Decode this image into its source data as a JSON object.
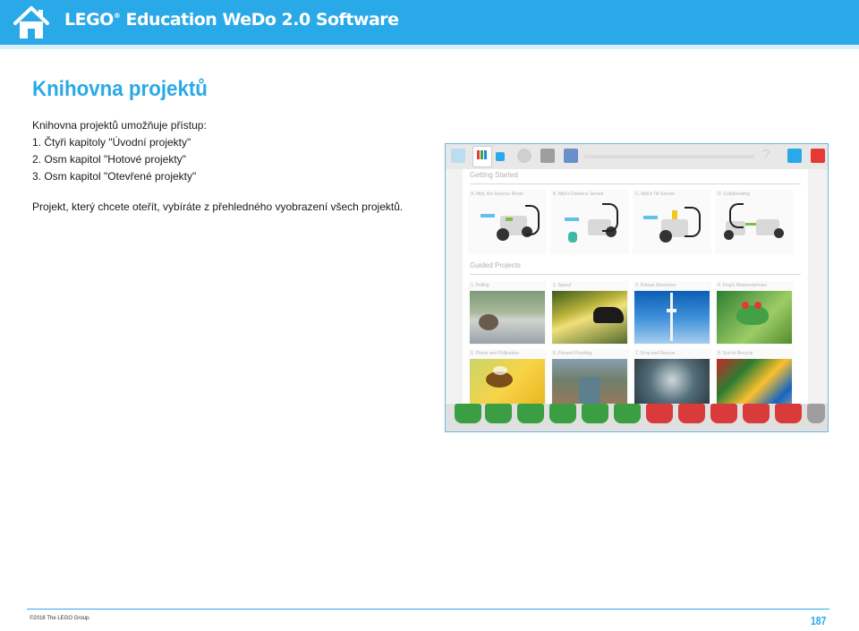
{
  "header": {
    "title_brand": "LEGO",
    "title_reg": "®",
    "title_rest": " Education WeDo 2.0 Software",
    "color": "#2aa9e8"
  },
  "page": {
    "title": "Knihovna projektů",
    "intro": "Knihovna projektů umožňuje přístup:",
    "items": [
      "1. Čtyři kapitoly \"Úvodní projekty\"",
      "2. Osm kapitol \"Hotové projekty\"",
      "3. Osm kapitol \"Otevřené projekty\""
    ],
    "paragraph": "Projekt, který chcete oteřít, vybíráte z přehledného vyobrazení všech projektů."
  },
  "screenshot": {
    "section1": "Getting Started",
    "section2": "Guided Projects",
    "getting_started": [
      "A. Milo, the Science Rover",
      "B. Milo's Distance Sensor",
      "C. Milo's Tilt Sensor",
      "D. Collaborating"
    ],
    "guided_row1": [
      "1. Pulling",
      "2. Speed",
      "3. Robust Structures",
      "4. Frog's Metamorphosis"
    ],
    "guided_row2": [
      "5. Plants and Pollinators",
      "6. Prevent Flooding",
      "7. Drop and Rescue",
      "8. Sort to Recycle"
    ]
  },
  "footer": {
    "copyright": "©2016 The LEGO Group.",
    "page_number": "187"
  }
}
